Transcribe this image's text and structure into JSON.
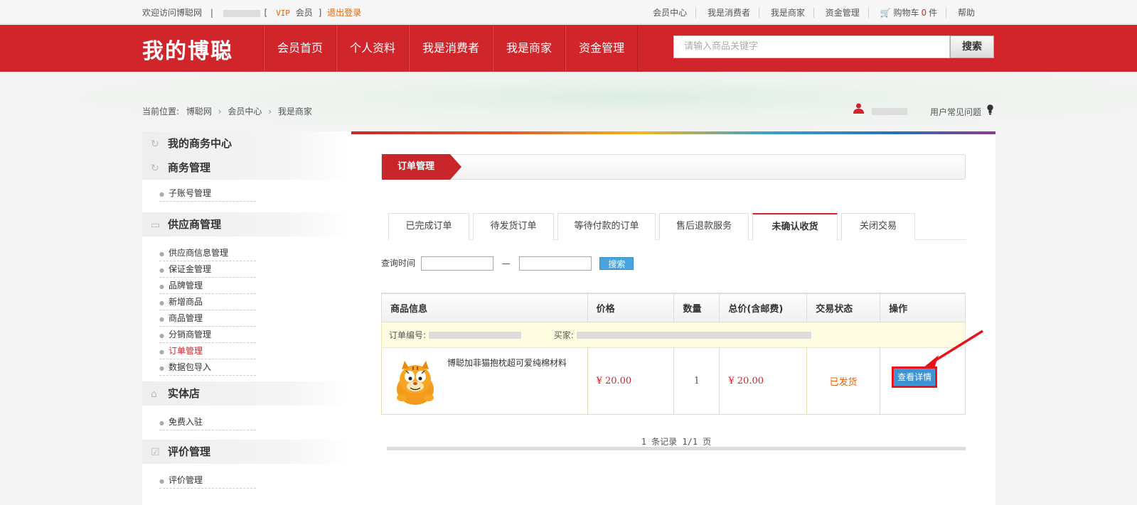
{
  "topbar": {
    "welcome": "欢迎访问博聪网",
    "sep1": "|",
    "bracket_open": "[",
    "vip": "VIP",
    "member": "会员",
    "bracket_close": "]",
    "logout": "退出登录",
    "links": [
      "会员中心",
      "我是消费者",
      "我是商家",
      "资金管理"
    ],
    "cart_label": "购物车",
    "cart_count": "0",
    "cart_unit": "件",
    "help": "帮助"
  },
  "header": {
    "logo": "我的博聪",
    "nav": [
      "会员首页",
      "个人资料",
      "我是消费者",
      "我是商家",
      "资金管理"
    ],
    "search_placeholder": "请输入商品关键字",
    "search_button": "搜索"
  },
  "breadcrumb": {
    "label": "当前位置:",
    "items": [
      "博聪网",
      "会员中心",
      "我是商家"
    ],
    "sep": "›"
  },
  "user": {
    "faq": "用户常见问题"
  },
  "sidebar": {
    "sections": [
      {
        "title": "我的商务中心",
        "icon": "refresh-icon",
        "items": []
      },
      {
        "title": "商务管理",
        "icon": "refresh-icon",
        "items": [
          "子账号管理"
        ]
      },
      {
        "title": "供应商管理",
        "icon": "card-icon",
        "items": [
          "供应商信息管理",
          "保证金管理",
          "品牌管理",
          "新增商品",
          "商品管理",
          "分销商管理",
          "订单管理",
          "数据包导入"
        ]
      },
      {
        "title": "实体店",
        "icon": "store-icon",
        "items": [
          "免费入驻"
        ]
      },
      {
        "title": "评价管理",
        "icon": "checkbox-icon",
        "items": [
          "评价管理"
        ]
      }
    ],
    "active_item": "订单管理"
  },
  "main": {
    "section_title": "订单管理",
    "tabs": [
      "已完成订单",
      "待发货订单",
      "等待付款的订单",
      "售后退款服务",
      "未确认收货",
      "关闭交易"
    ],
    "active_tab": "未确认收货",
    "query_label": "查询时间",
    "query_dash": "—",
    "query_button": "搜索",
    "table": {
      "headers": [
        "商品信息",
        "价格",
        "数量",
        "总价(含邮费)",
        "交易状态",
        "操作"
      ],
      "order_no_label": "订单编号:",
      "buyer_label": "买家:",
      "product_name": "博聪加菲猫抱枕超可爱纯棉材料",
      "price": "¥ 20.00",
      "qty": "1",
      "total": "¥ 20.00",
      "status": "已发货",
      "action": "查看详情"
    },
    "pager": "1 条记录 1/1 页"
  },
  "colors": {
    "brand_red": "#d0252b",
    "orange": "#e8640b",
    "blue_button": "#4aa3df",
    "highlight_red": "#e8141b"
  }
}
